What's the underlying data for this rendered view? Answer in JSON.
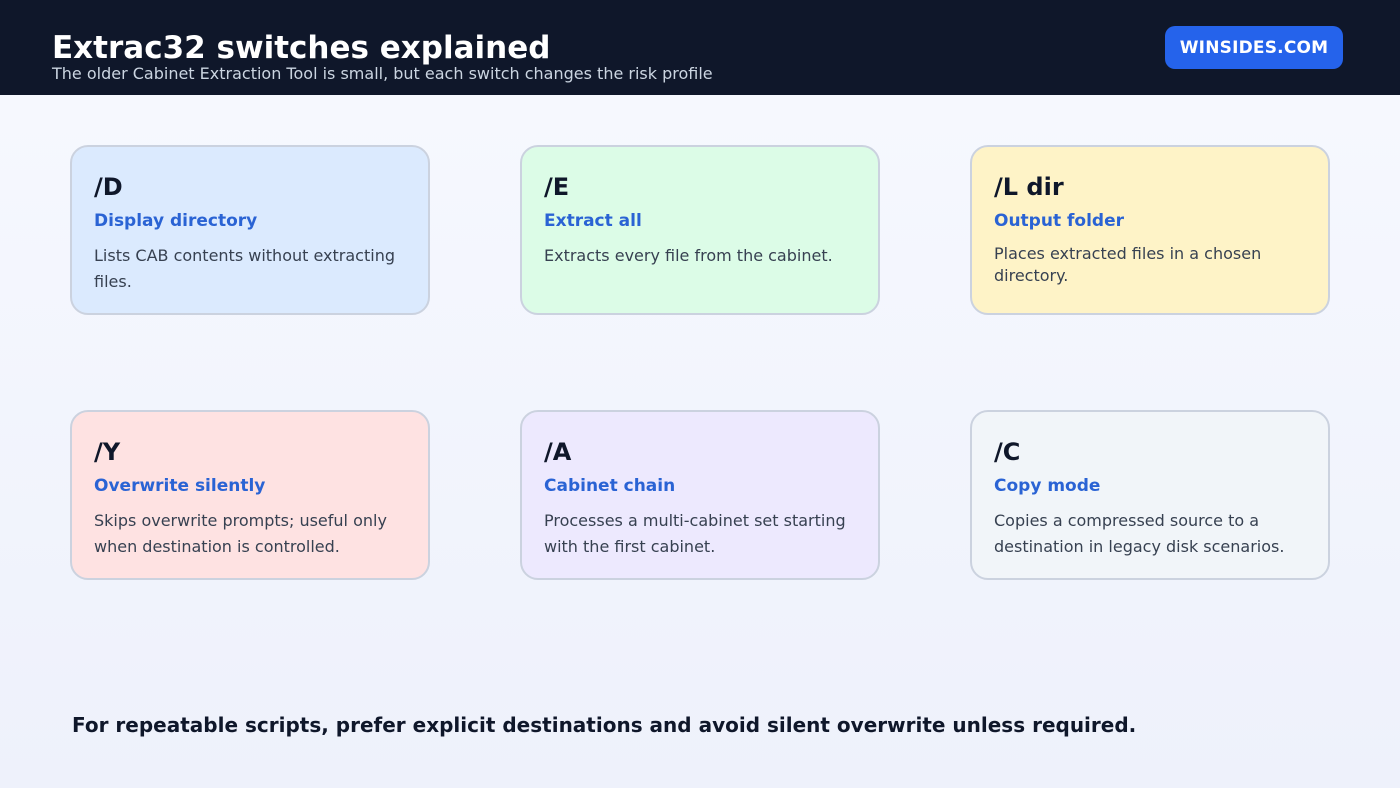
{
  "header": {
    "title": "Extrac32 switches explained",
    "subtitle": "The older Cabinet Extraction Tool is small, but each switch changes the risk profile",
    "brand": "WINSIDES.COM",
    "background_color": "#0f172a",
    "brand_color": "#2563eb"
  },
  "cards": [
    {
      "switch": "/D",
      "title": "Display directory",
      "description": "Lists CAB contents without extracting files.",
      "color": "#dbeafe"
    },
    {
      "switch": "/E",
      "title": "Extract all",
      "description": "Extracts every file from the cabinet.",
      "color": "#dcfce7"
    },
    {
      "switch": "/L dir",
      "title": "Output folder",
      "description": "Places extracted files in a chosen directory.",
      "color": "#fef3c7"
    },
    {
      "switch": "/Y",
      "title": "Overwrite silently",
      "description": "Skips overwrite prompts; useful only when destination is controlled.",
      "color": "#fee2e2"
    },
    {
      "switch": "/A",
      "title": "Cabinet chain",
      "description": "Processes a multi-cabinet set starting with the first cabinet.",
      "color": "#ede9fe"
    },
    {
      "switch": "/C",
      "title": "Copy mode",
      "description": "Copies a compressed source to a destination in legacy disk scenarios.",
      "color": "#f1f5f9"
    }
  ],
  "footer": {
    "note": "For repeatable scripts, prefer explicit destinations and avoid silent overwrite unless required."
  },
  "accent_color": "#2a63d4"
}
